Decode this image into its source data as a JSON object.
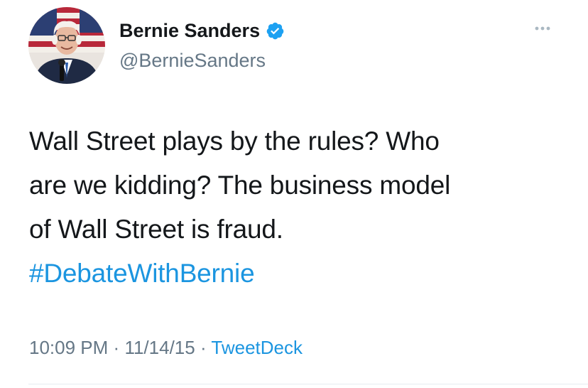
{
  "author": {
    "name": "Bernie Sanders",
    "handle": "@BernieSanders",
    "verified": true,
    "avatar_icon": "profile-photo"
  },
  "tweet": {
    "line1": "Wall Street plays by the rules? Who",
    "line2": "are we kidding? The business model",
    "line3": "of Wall Street is fraud.",
    "hashtag": "#DebateWithBernie"
  },
  "meta": {
    "time": "10:09 PM",
    "date": "11/14/15",
    "separator": "·",
    "source": "TweetDeck"
  },
  "colors": {
    "link": "#1b95e0",
    "secondary_text": "#657786",
    "verified_badge": "#1da1f2",
    "primary_text": "#14171a"
  },
  "icons": {
    "more": "more-dots-icon",
    "verified": "verified-badge-icon"
  }
}
